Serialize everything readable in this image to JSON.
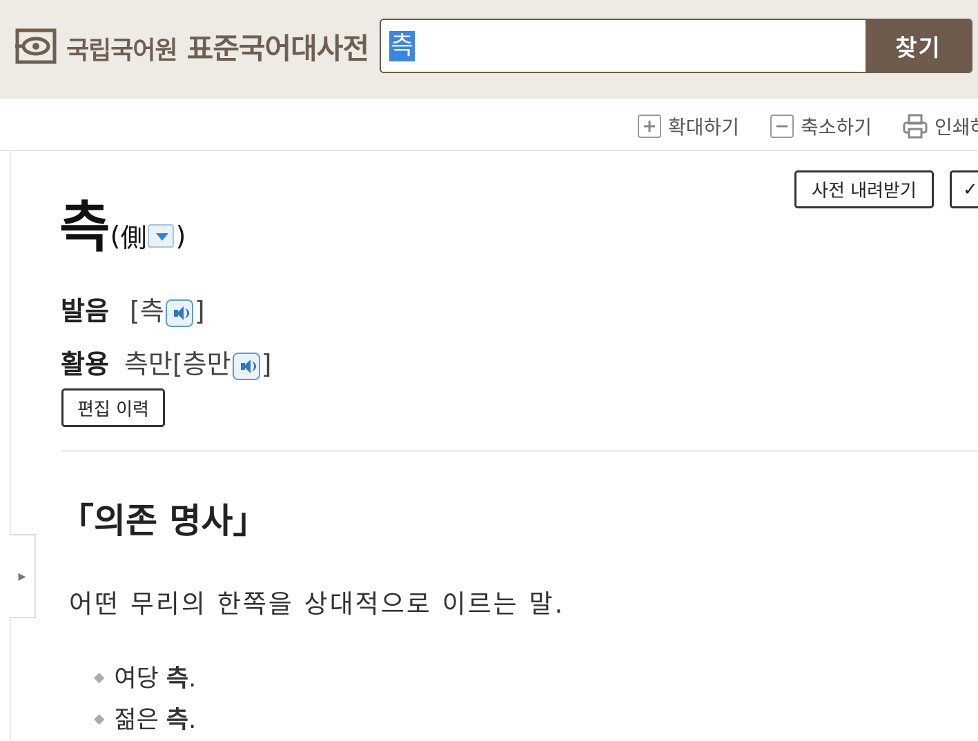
{
  "header": {
    "org_name": "국립국어원",
    "dictionary_name": "표준국어대사전",
    "search": {
      "value": "측",
      "button_label": "찾기"
    }
  },
  "toolbar": {
    "zoom_in_label": "확대하기",
    "zoom_out_label": "축소하기",
    "print_label": "인쇄하",
    "icons": [
      "plus-box-icon",
      "minus-box-icon",
      "printer-icon"
    ]
  },
  "actions": {
    "download_label": "사전 내려받기",
    "check_label": "✓"
  },
  "entry": {
    "headword": "측",
    "hanja": "側",
    "pronunciation": {
      "label": "발음",
      "open": "[측",
      "close": "]"
    },
    "conjugation": {
      "label": "활용",
      "form": "측만",
      "open": "[층만",
      "close": "]"
    },
    "edit_history_label": "편집 이력",
    "part_of_speech": "「의존 명사」",
    "definition": "어떤 무리의 한쪽을 상대적으로 이르는 말.",
    "examples": [
      {
        "prefix": "여당 ",
        "word": "측",
        "suffix": "."
      },
      {
        "prefix": "젊은 ",
        "word": "측",
        "suffix": "."
      }
    ]
  },
  "colors": {
    "header_bg": "#edebe4",
    "brand_brown": "#6e5b4d",
    "selection_blue": "#3a86e3",
    "speaker_blue": "#2f78c0"
  }
}
